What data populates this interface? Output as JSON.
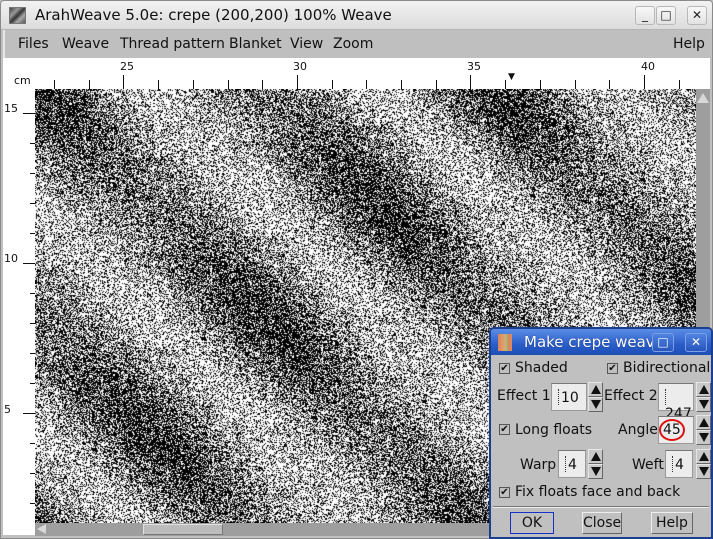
{
  "window": {
    "title": "ArahWeave 5.0e: crepe (200,200) 100% Weave",
    "icon": "arahweave-app-icon",
    "controls": {
      "minimize": "_",
      "maximize": "□",
      "close": "✕"
    }
  },
  "menubar": {
    "items": [
      "Files",
      "Weave",
      "Thread pattern",
      "Blanket",
      "View",
      "Zoom"
    ],
    "help": "Help"
  },
  "ruler": {
    "unit": "cm",
    "top_labels": [
      "25",
      "30",
      "35",
      "40"
    ],
    "left_labels": [
      "15",
      "10",
      "5"
    ],
    "marker": "▼"
  },
  "canvas": {
    "description": "crepe weave pattern, black and white, diagonal shaded bands",
    "colors": {
      "warp": "#000000",
      "weft": "#ffffff"
    }
  },
  "dialog": {
    "title": "Make crepe weave",
    "controls": {
      "maximize": "□",
      "close": "✕"
    },
    "shaded": {
      "label": "Shaded",
      "checked": true
    },
    "bidirectional": {
      "label": "Bidirectional",
      "checked": true
    },
    "effect1": {
      "label": "Effect 1",
      "value": "10"
    },
    "effect2": {
      "label": "Effect 2",
      "value": "247"
    },
    "long_floats": {
      "label": "Long floats",
      "checked": true
    },
    "angle": {
      "label": "Angle",
      "value": "45"
    },
    "warp": {
      "label": "Warp",
      "value": "4"
    },
    "weft": {
      "label": "Weft",
      "value": "4"
    },
    "fix_floats": {
      "label": "Fix floats face and back",
      "checked": true
    },
    "buttons": {
      "ok": "OK",
      "close": "Close",
      "help": "Help"
    },
    "check_mark": "✔",
    "annotation_color": "#e01010"
  }
}
